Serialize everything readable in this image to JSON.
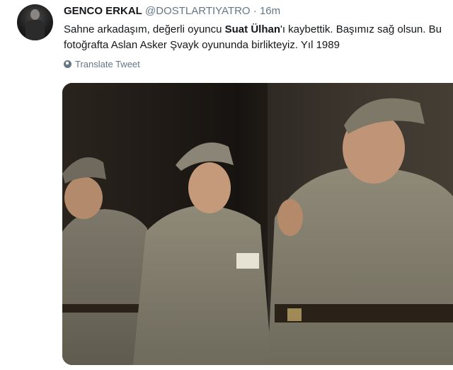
{
  "tweet": {
    "name": "GENCO ERKAL",
    "handle": "@DOSTLARTIYATRO",
    "separator": "·",
    "time": "16m",
    "text_before": "Sahne arkadaşım, değerli oyuncu ",
    "text_bold": "Suat Ülhan",
    "text_after": "'ı kaybettik. Başımız sağ olsun. Bu fotoğrafta Aslan Asker Şvayk oyununda birlikteyiz. Yıl 1989",
    "translate_label": "Translate Tweet"
  },
  "icons": {
    "translate": "globe-icon"
  },
  "colors": {
    "text": "#14171a",
    "secondary": "#657786",
    "background": "#ffffff"
  }
}
